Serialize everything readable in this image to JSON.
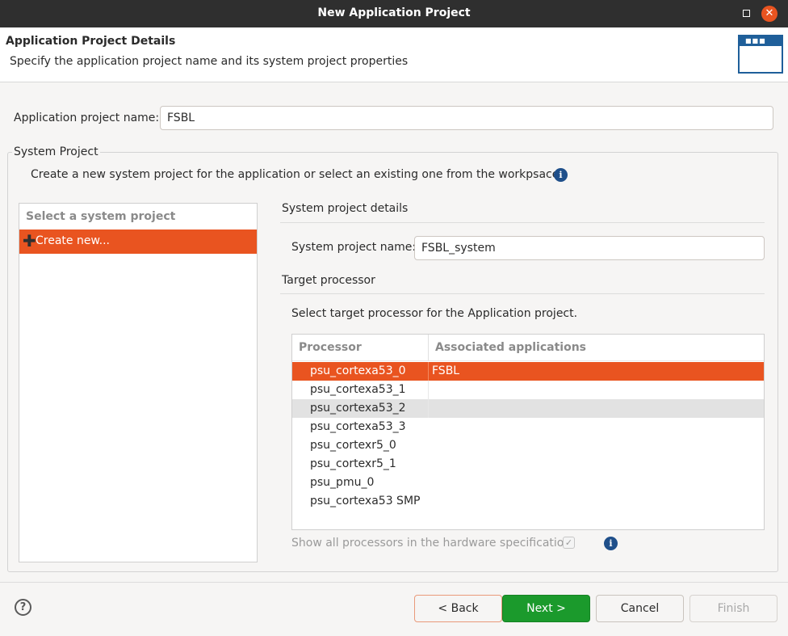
{
  "window": {
    "title": "New Application Project",
    "maximize_glyph": "",
    "close_glyph": "✕"
  },
  "header": {
    "title": "Application Project Details",
    "description": "Specify the application project name and its system project properties",
    "icon": "wizard-window-icon"
  },
  "app_project": {
    "label": "Application project name:",
    "value": "FSBL"
  },
  "system_project": {
    "group_title": "System Project",
    "description": "Create a new system project for the application or select an existing one from the workpsace",
    "list_header": "Select a system project",
    "list_items": [
      {
        "label": "Create new...",
        "icon": "plus-icon"
      }
    ],
    "details_title": "System project details",
    "name_label": "System project name:",
    "name_value": "FSBL_system"
  },
  "target_processor": {
    "title": "Target processor",
    "description": "Select target processor for the Application project.",
    "columns": [
      "Processor",
      "Associated applications"
    ],
    "rows": [
      {
        "processor": "psu_cortexa53_0",
        "app": "FSBL"
      },
      {
        "processor": "psu_cortexa53_1",
        "app": ""
      },
      {
        "processor": "psu_cortexa53_2",
        "app": ""
      },
      {
        "processor": "psu_cortexa53_3",
        "app": ""
      },
      {
        "processor": "psu_cortexr5_0",
        "app": ""
      },
      {
        "processor": "psu_cortexr5_1",
        "app": ""
      },
      {
        "processor": "psu_pmu_0",
        "app": ""
      },
      {
        "processor": "psu_cortexa53 SMP",
        "app": ""
      }
    ],
    "selected_row": "psu_cortexa53_0",
    "show_all_label": "Show all processors in the hardware specification",
    "show_all_checked": true
  },
  "footer": {
    "help": "?",
    "back": "< Back",
    "next": "Next >",
    "cancel": "Cancel",
    "finish": "Finish"
  },
  "colors": {
    "accent": "#e95420",
    "primary_button": "#1b9a2c",
    "info": "#1f4f8a"
  }
}
